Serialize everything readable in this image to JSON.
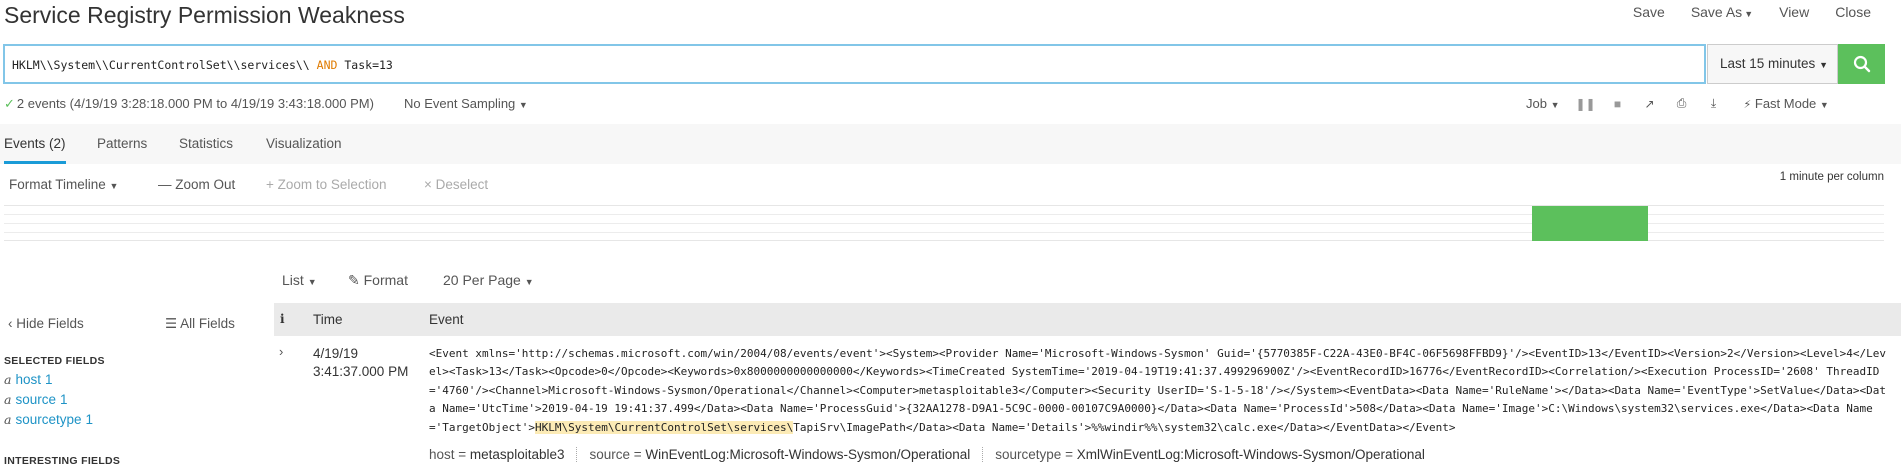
{
  "header": {
    "title": "Service Registry Permission Weakness",
    "actions": [
      "Save",
      "Save As",
      "View",
      "Close"
    ]
  },
  "search": {
    "query_part1": "HKLM\\\\System\\\\CurrentControlSet\\\\services\\\\",
    "query_keyword": "AND",
    "query_part2": "Task=13",
    "time_range": "Last 15 minutes"
  },
  "status": {
    "summary": "2 events (4/19/19 3:28:18.000 PM to 4/19/19 3:43:18.000 PM)",
    "sampling": "No Event Sampling",
    "job": "Job",
    "mode": "Fast Mode"
  },
  "tabs": [
    "Events (2)",
    "Patterns",
    "Statistics",
    "Visualization"
  ],
  "timeline": {
    "format": "Format Timeline",
    "zoom_out": "Zoom Out",
    "zoom_selection": "Zoom to Selection",
    "deselect": "Deselect",
    "per_column": "1 minute per column"
  },
  "results": {
    "list": "List",
    "format": "Format",
    "per_page": "20 Per Page"
  },
  "fields": {
    "hide": "Hide Fields",
    "all": "All Fields",
    "selected_heading": "SELECTED FIELDS",
    "selected": [
      {
        "name": "host",
        "count": "1"
      },
      {
        "name": "source",
        "count": "1"
      },
      {
        "name": "sourcetype",
        "count": "1"
      }
    ],
    "interesting_heading": "INTERESTING FIELDS",
    "type_glyph": "a"
  },
  "table": {
    "col_info": "i",
    "col_time": "Time",
    "col_event": "Event"
  },
  "event": {
    "date": "4/19/19",
    "time": "3:41:37.000 PM",
    "raw_before": "<Event xmlns='http://schemas.microsoft.com/win/2004/08/events/event'><System><Provider Name='Microsoft-Windows-Sysmon' Guid='{5770385F-C22A-43E0-BF4C-06F5698FFBD9}'/><EventID>13</EventID><Version>2</Version><Level>4</Level><Task>13</Task><Opcode>0</Opcode><Keywords>0x8000000000000000</Keywords><TimeCreated SystemTime='2019-04-19T19:41:37.499296900Z'/><EventRecordID>16776</EventRecordID><Correlation/><Execution ProcessID='2608' ThreadID='4760'/><Channel>Microsoft-Windows-Sysmon/Operational</Channel><Computer>metasploitable3</Computer><Security UserID='S-1-5-18'/></System><EventData><Data Name='RuleName'></Data><Data Name='EventType'>SetValue</Data><Data Name='UtcTime'>2019-04-19 19:41:37.499</Data><Data Name='ProcessGuid'>{32AA1278-D9A1-5C9C-0000-00107C9A0000}</Data><Data Name='ProcessId'>508</Data><Data Name='Image'>C:\\Windows\\system32\\services.exe</Data><Data Name='TargetObject'>",
    "raw_highlight": "HKLM\\System\\CurrentControlSet\\services\\",
    "raw_after": "TapiSrv\\ImagePath</Data><Data Name='Details'>%%windir%%\\system32\\calc.exe</Data></EventData></Event>",
    "meta": [
      {
        "key": "host",
        "value": "metasploitable3"
      },
      {
        "key": "source",
        "value": "WinEventLog:Microsoft-Windows-Sysmon/Operational"
      },
      {
        "key": "sourcetype",
        "value": "XmlWinEventLog:Microsoft-Windows-Sysmon/Operational"
      }
    ]
  },
  "colors": {
    "accent": "#1a9bd7",
    "success": "#5cc05c",
    "keyword": "#e07b00",
    "highlight": "#fcebb6"
  }
}
